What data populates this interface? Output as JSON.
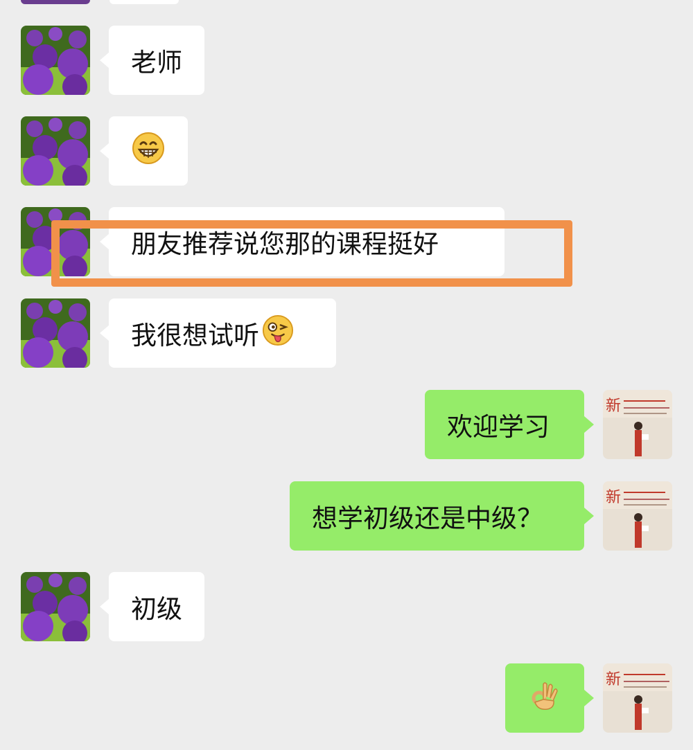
{
  "messages": [
    {
      "side": "in",
      "text": "老师",
      "emoji": ""
    },
    {
      "side": "in",
      "text": "",
      "emoji": "grin"
    },
    {
      "side": "in",
      "text": "朋友推荐说您那的课程挺好",
      "emoji": ""
    },
    {
      "side": "in",
      "text": "我很想试听",
      "emoji": "wink-tongue"
    },
    {
      "side": "out",
      "text": "欢迎学习",
      "emoji": ""
    },
    {
      "side": "out",
      "text": "想学初级还是中级？",
      "emoji": ""
    },
    {
      "side": "in",
      "text": "初级",
      "emoji": ""
    },
    {
      "side": "out",
      "text": "",
      "emoji": "ok-hand"
    }
  ],
  "avatars": {
    "contact": "purple-flower-avatar",
    "self": "certificate-photo-avatar"
  },
  "colors": {
    "background": "#ededed",
    "incoming_bubble": "#ffffff",
    "outgoing_bubble": "#95ec69",
    "highlight_border": "#f1914a"
  }
}
